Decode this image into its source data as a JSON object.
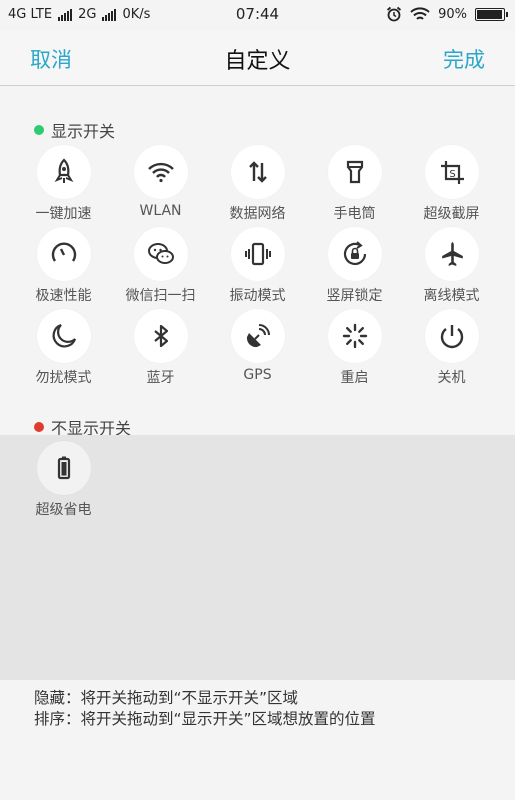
{
  "status_bar": {
    "network1": "4G LTE",
    "network2": "2G",
    "speed": "0K/s",
    "time": "07:44",
    "battery": "90%",
    "battery_level": 0.9
  },
  "nav": {
    "cancel": "取消",
    "title": "自定义",
    "done": "完成"
  },
  "shown_section": {
    "title": "显示开关",
    "dot_color": "#2ecc71",
    "items": [
      {
        "label": "一键加速",
        "icon": "rocket-icon"
      },
      {
        "label": "WLAN",
        "icon": "wifi-icon"
      },
      {
        "label": "数据网络",
        "icon": "data-arrows-icon"
      },
      {
        "label": "手电筒",
        "icon": "flashlight-icon"
      },
      {
        "label": "超级截屏",
        "icon": "screenshot-icon"
      },
      {
        "label": "极速性能",
        "icon": "speedometer-icon"
      },
      {
        "label": "微信扫一扫",
        "icon": "wechat-icon"
      },
      {
        "label": "振动模式",
        "icon": "vibrate-icon"
      },
      {
        "label": "竖屏锁定",
        "icon": "rotation-lock-icon"
      },
      {
        "label": "离线模式",
        "icon": "airplane-icon"
      },
      {
        "label": "勿扰模式",
        "icon": "moon-icon"
      },
      {
        "label": "蓝牙",
        "icon": "bluetooth-icon"
      },
      {
        "label": "GPS",
        "icon": "gps-icon"
      },
      {
        "label": "重启",
        "icon": "restart-icon"
      },
      {
        "label": "关机",
        "icon": "power-icon"
      }
    ]
  },
  "hidden_section": {
    "title": "不显示开关",
    "dot_color": "#e03b2f",
    "items": [
      {
        "label": "超级省电",
        "icon": "battery-icon"
      }
    ]
  },
  "footer": {
    "line1": "隐藏：将开关拖动到“不显示开关”区域",
    "line2": "排序：将开关拖动到“显示开关”区域想放置的位置"
  },
  "colors": {
    "accent": "#2aa7c9",
    "background": "#f4f4f4",
    "hidden_area": "#e4e4e4"
  }
}
